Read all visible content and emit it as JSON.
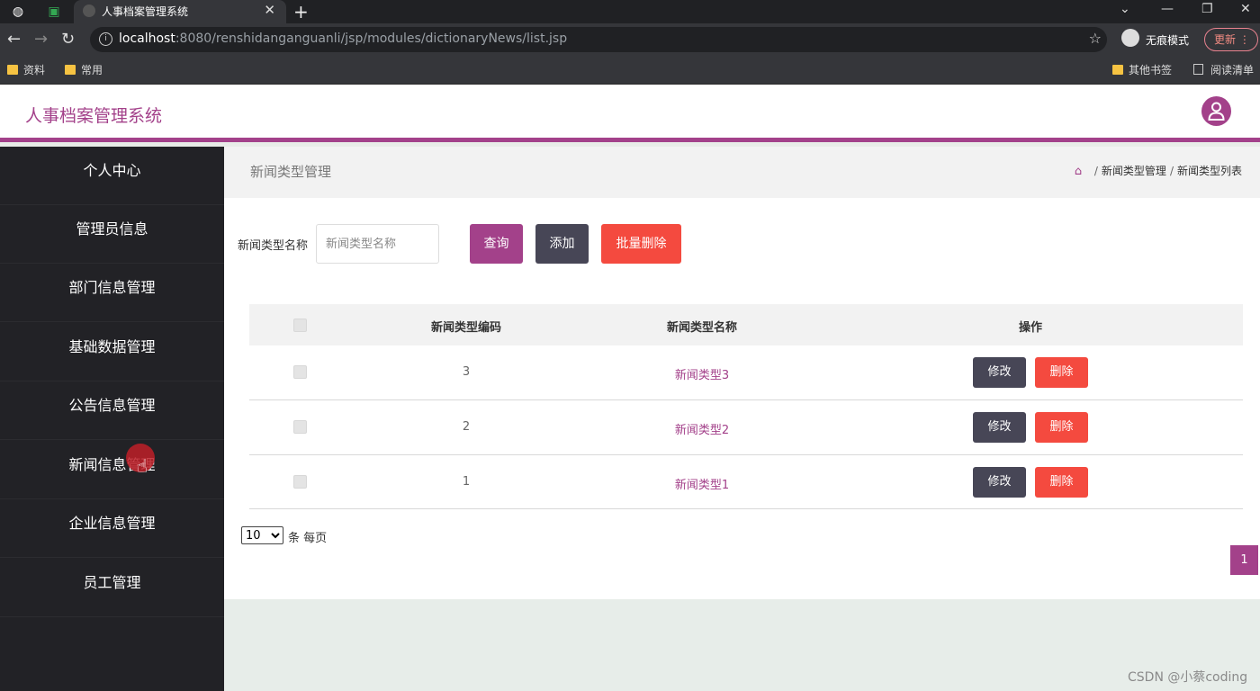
{
  "browser": {
    "tab_title": "人事档案管理系统",
    "url_host": "localhost",
    "url_rest": ":8080/renshidanganguanli/jsp/modules/dictionaryNews/list.jsp",
    "incognito_label": "无痕模式",
    "update_label": "更新",
    "bookmarks": [
      "资料",
      "常用"
    ],
    "other_bookmarks": "其他书签",
    "reading_list": "阅读清单"
  },
  "header": {
    "title": "人事档案管理系统"
  },
  "sidebar": {
    "items": [
      {
        "label": "个人中心"
      },
      {
        "label": "管理员信息"
      },
      {
        "label": "部门信息管理"
      },
      {
        "label": "基础数据管理"
      },
      {
        "label": "公告信息管理"
      },
      {
        "label": "新闻信息管理"
      },
      {
        "label": "企业信息管理"
      },
      {
        "label": "员工管理"
      }
    ]
  },
  "page": {
    "title": "新闻类型管理",
    "breadcrumb": [
      "新闻类型管理",
      "新闻类型列表"
    ]
  },
  "search": {
    "label": "新闻类型名称",
    "placeholder": "新闻类型名称",
    "value": "",
    "query_label": "查询",
    "add_label": "添加",
    "batch_delete_label": "批量删除"
  },
  "table": {
    "columns": [
      "新闻类型编码",
      "新闻类型名称",
      "操作"
    ],
    "rows": [
      {
        "code": "3",
        "name": "新闻类型3"
      },
      {
        "code": "2",
        "name": "新闻类型2"
      },
      {
        "code": "1",
        "name": "新闻类型1"
      }
    ],
    "edit_label": "修改",
    "delete_label": "删除"
  },
  "pagination": {
    "page_size": "10",
    "page_size_label": "条 每页",
    "current_page": "1"
  },
  "watermark": "CSDN @小蔡coding",
  "colors": {
    "accent": "#a3418a",
    "dark_button": "#474656",
    "danger": "#f44a3f",
    "sidebar_bg": "#222226"
  }
}
